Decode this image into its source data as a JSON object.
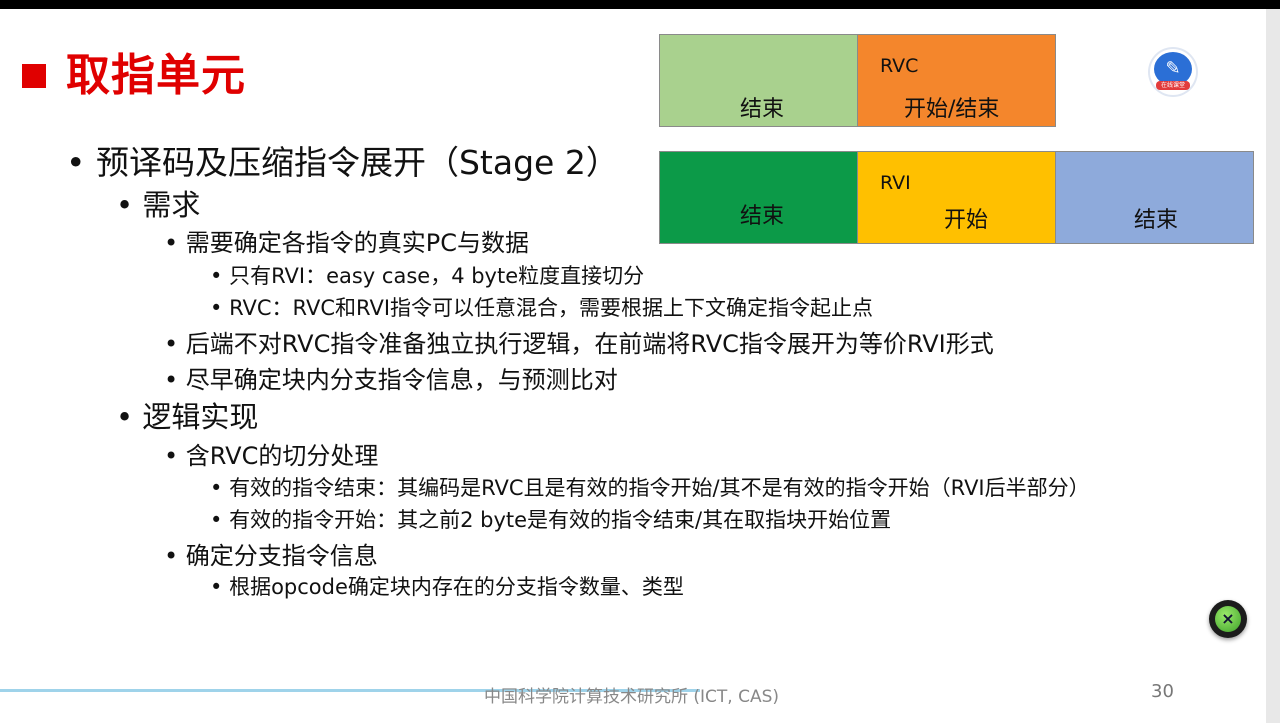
{
  "slide": {
    "title": "取指单元",
    "bullets": [
      {
        "level": 1,
        "text": "预译码及压缩指令展开（Stage 2）"
      },
      {
        "level": 2,
        "text": "需求"
      },
      {
        "level": 3,
        "text": "需要确定各指令的真实PC与数据"
      },
      {
        "level": 4,
        "text": "只有RVI：easy case，4 byte粒度直接切分"
      },
      {
        "level": 4,
        "text": "RVC：RVC和RVI指令可以任意混合，需要根据上下文确定指令起止点"
      },
      {
        "level": 3,
        "text": "后端不对RVC指令准备独立执行逻辑，在前端将RVC指令展开为等价RVI形式"
      },
      {
        "level": 3,
        "text": "尽早确定块内分支指令信息，与预测比对"
      },
      {
        "level": 2,
        "text": "逻辑实现"
      },
      {
        "level": 3,
        "text": "含RVC的切分处理"
      },
      {
        "level": 4,
        "text": "有效的指令结束：其编码是RVC且是有效的指令开始/其不是有效的指令开始（RVI后半部分）"
      },
      {
        "level": 4,
        "text": "有效的指令开始：其之前2 byte是有效的指令结束/其在取指块开始位置"
      },
      {
        "level": 3,
        "text": "确定分支指令信息"
      },
      {
        "level": 4,
        "text": "根据opcode确定块内存在的分支指令数量、类型"
      }
    ],
    "bullet_symbol": "•",
    "diagram": {
      "row1": [
        {
          "tag": "",
          "label": "结束",
          "color": "#a9d18e"
        },
        {
          "tag": "RVC",
          "label": "开始/结束",
          "color": "#f4862c"
        }
      ],
      "row2": [
        {
          "tag": "",
          "label": "结束",
          "color": "#0c9a48"
        },
        {
          "tag": "RVI",
          "label": "开始",
          "color": "#ffc000"
        },
        {
          "tag": "",
          "label": "结束",
          "color": "#8eaadb"
        }
      ]
    },
    "logo": {
      "name": "课堂 logo",
      "caption": "在线课堂"
    },
    "close_button_glyph": "×",
    "footer": "中国科学院计算技术研究所 (ICT, CAS)",
    "page_number": "30",
    "accent_color": "#e00000"
  }
}
